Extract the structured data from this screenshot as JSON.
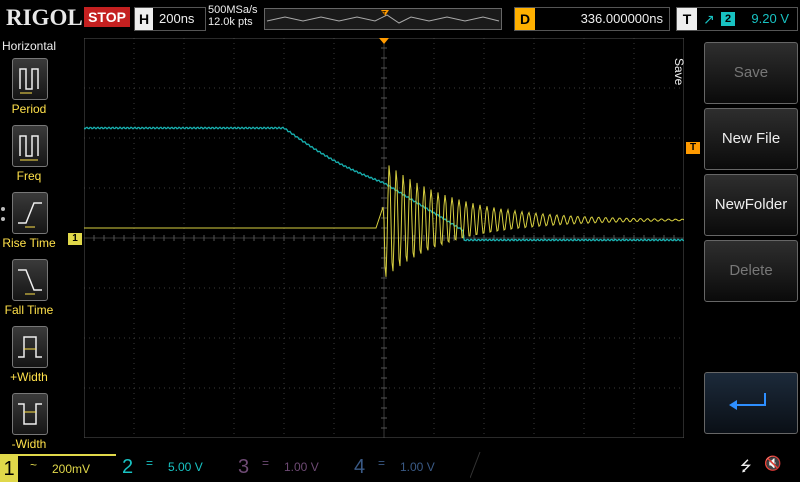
{
  "brand": "RIGOL",
  "run_state": "STOP",
  "timebase": {
    "letter": "H",
    "value": "200ns"
  },
  "acquisition": {
    "sample_rate": "500MSa/s",
    "memory_depth": "12.0k pts"
  },
  "delay": {
    "letter": "D",
    "value": "336.000000ns"
  },
  "trigger": {
    "letter": "T",
    "edge_glyph": "↗",
    "source": "2",
    "level": "9.20 V"
  },
  "left_menu": {
    "title": "Horizontal",
    "items": [
      {
        "label": "Period"
      },
      {
        "label": "Freq"
      },
      {
        "label": "Rise Time"
      },
      {
        "label": "Fall Time"
      },
      {
        "label": "+Width"
      },
      {
        "label": "-Width"
      }
    ]
  },
  "right_menu": {
    "title": "Save",
    "items": [
      {
        "label": "Save",
        "enabled": false
      },
      {
        "label": "New File",
        "enabled": true
      },
      {
        "label": "NewFolder",
        "enabled": true
      },
      {
        "label": "Delete",
        "enabled": false
      }
    ],
    "back_icon": "return-arrow-icon"
  },
  "markers": {
    "ch1_level": "1",
    "trigger_level": "T"
  },
  "channels": [
    {
      "num": "1",
      "coupling": "~",
      "scale": "200mV",
      "color": "#e0d84a",
      "active": true
    },
    {
      "num": "2",
      "coupling": "=",
      "scale": "5.00 V",
      "color": "#18c2c2",
      "active": false
    },
    {
      "num": "3",
      "coupling": "=",
      "scale": "1.00 V",
      "color": "#6e4a74",
      "active": false
    },
    {
      "num": "4",
      "coupling": "=",
      "scale": "1.00 V",
      "color": "#3a5a86",
      "active": false
    }
  ],
  "status_icons": {
    "usb": "usb-icon",
    "sound": "speaker-muted-icon"
  },
  "colors": {
    "grid": "#3a3a3a",
    "ch1": "#d8d040",
    "ch2": "#18b0b0",
    "trigger": "#ff9a00"
  }
}
